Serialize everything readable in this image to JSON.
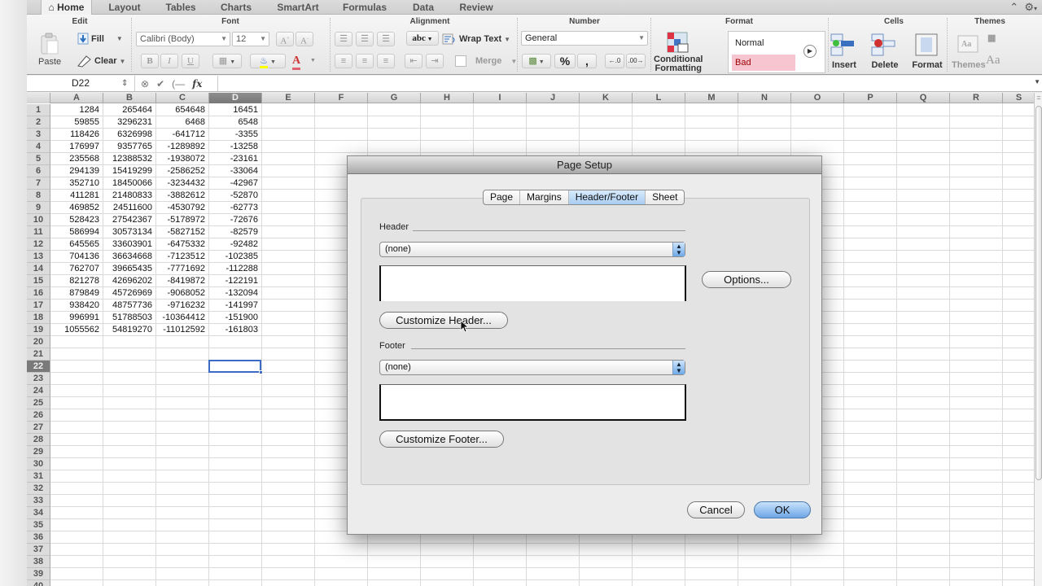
{
  "ribbon": {
    "tabs": [
      {
        "label": "Home",
        "active": true
      },
      {
        "label": "Layout"
      },
      {
        "label": "Tables"
      },
      {
        "label": "Charts"
      },
      {
        "label": "SmartArt"
      },
      {
        "label": "Formulas"
      },
      {
        "label": "Data"
      },
      {
        "label": "Review"
      }
    ],
    "groups": {
      "edit": {
        "title": "Edit",
        "paste": "Paste",
        "fill": "Fill",
        "clear": "Clear"
      },
      "font": {
        "title": "Font",
        "font_name": "Calibri (Body)",
        "font_size": "12",
        "bold": "B",
        "italic": "I",
        "underline": "U"
      },
      "alignment": {
        "title": "Alignment",
        "orientation": "abc",
        "wrap_text": "Wrap Text",
        "merge": "Merge"
      },
      "number": {
        "title": "Number",
        "format": "General",
        "percent": "%",
        "comma": ","
      },
      "format": {
        "title": "Format",
        "conditional_1": "Conditional",
        "conditional_2": "Formatting",
        "style_normal": "Normal",
        "style_bad": "Bad"
      },
      "cells": {
        "title": "Cells",
        "insert": "Insert",
        "delete": "Delete",
        "format": "Format"
      },
      "themes": {
        "title": "Themes",
        "themes": "Themes"
      }
    },
    "colors": {
      "highlight": "#ffff00",
      "font_color": "#e06070",
      "bad_style_bg": "#f7c5cf"
    }
  },
  "formula_bar": {
    "name_box": "D22",
    "fx": "fx",
    "value": ""
  },
  "sheet": {
    "columns": [
      "A",
      "B",
      "C",
      "D",
      "E",
      "F",
      "G",
      "H",
      "I",
      "J",
      "K",
      "L",
      "M",
      "N",
      "O",
      "P",
      "Q",
      "R",
      "S"
    ],
    "selected_column": "D",
    "selected_row": 22,
    "active_cell": "D22",
    "row_numbers": [
      "1",
      "2",
      "3",
      "4",
      "5",
      "6",
      "7",
      "8",
      "9",
      "10",
      "11",
      "12",
      "13",
      "14",
      "15",
      "16",
      "17",
      "18",
      "19",
      "20",
      "21",
      "22",
      "23",
      "24",
      "25",
      "26",
      "27",
      "28",
      "29",
      "30",
      "31",
      "32",
      "33",
      "34",
      "35",
      "36",
      "37",
      "38",
      "39",
      "40"
    ],
    "rows": [
      [
        "1284",
        "265464",
        "654648",
        "16451"
      ],
      [
        "59855",
        "3296231",
        "6468",
        "6548"
      ],
      [
        "118426",
        "6326998",
        "-641712",
        "-3355"
      ],
      [
        "176997",
        "9357765",
        "-1289892",
        "-13258"
      ],
      [
        "235568",
        "12388532",
        "-1938072",
        "-23161"
      ],
      [
        "294139",
        "15419299",
        "-2586252",
        "-33064"
      ],
      [
        "352710",
        "18450066",
        "-3234432",
        "-42967"
      ],
      [
        "411281",
        "21480833",
        "-3882612",
        "-52870"
      ],
      [
        "469852",
        "24511600",
        "-4530792",
        "-62773"
      ],
      [
        "528423",
        "27542367",
        "-5178972",
        "-72676"
      ],
      [
        "586994",
        "30573134",
        "-5827152",
        "-82579"
      ],
      [
        "645565",
        "33603901",
        "-6475332",
        "-92482"
      ],
      [
        "704136",
        "36634668",
        "-7123512",
        "-102385"
      ],
      [
        "762707",
        "39665435",
        "-7771692",
        "-112288"
      ],
      [
        "821278",
        "42696202",
        "-8419872",
        "-122191"
      ],
      [
        "879849",
        "45726969",
        "-9068052",
        "-132094"
      ],
      [
        "938420",
        "48757736",
        "-9716232",
        "-141997"
      ],
      [
        "996991",
        "51788503",
        "-10364412",
        "-151900"
      ],
      [
        "1055562",
        "54819270",
        "-11012592",
        "-161803"
      ]
    ]
  },
  "dialog": {
    "title": "Page Setup",
    "tabs": [
      {
        "label": "Page"
      },
      {
        "label": "Margins"
      },
      {
        "label": "Header/Footer",
        "active": true
      },
      {
        "label": "Sheet"
      }
    ],
    "header_label": "Header",
    "header_value": "(none)",
    "footer_label": "Footer",
    "footer_value": "(none)",
    "options_button": "Options...",
    "customize_header_button": "Customize Header...",
    "customize_footer_button": "Customize Footer...",
    "cancel_button": "Cancel",
    "ok_button": "OK"
  }
}
